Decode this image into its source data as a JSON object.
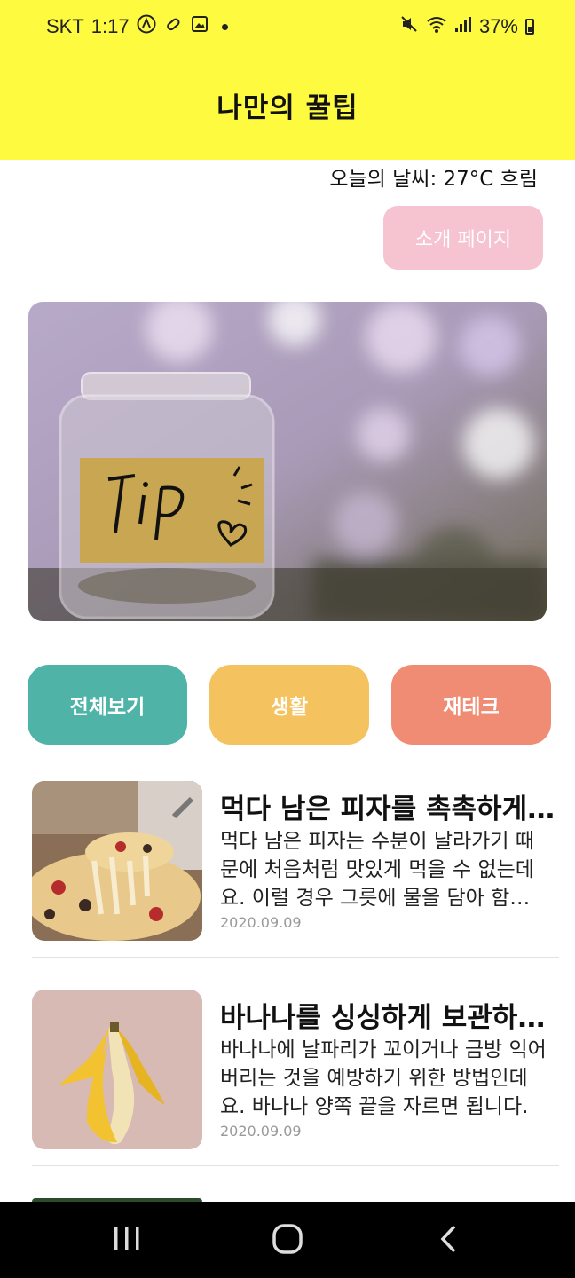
{
  "status_bar": {
    "carrier": "SKT",
    "time": "1:17",
    "battery": "37%",
    "icons_left": [
      "app-a-icon",
      "link-icon",
      "image-icon",
      "dot-icon"
    ],
    "icons_right": [
      "mute-icon",
      "wifi-icon",
      "signal-icon",
      "battery-icon"
    ]
  },
  "header": {
    "title": "나만의 꿀팁",
    "background": "#fdfa3f"
  },
  "weather": "오늘의 날씨: 27°C 흐림",
  "intro_button": {
    "label": "소개 페이지",
    "color": "#f5c4d0"
  },
  "hero": {
    "label_text": "TiP"
  },
  "categories": [
    {
      "label": "전체보기",
      "color": "#4fb3a8"
    },
    {
      "label": "생활",
      "color": "#f4c35f"
    },
    {
      "label": "재테크",
      "color": "#f08c73"
    }
  ],
  "tips": [
    {
      "title": "먹다 남은 피자를 촉촉하게 만드는 방법",
      "desc": "먹다 남은 피자는 수분이 날라가기 때문에 처음처럼 맛있게 먹을 수 없는데요. 이럴 경우 그릇에 물을 담아 함께 데워주세요.",
      "date": "2020.09.09",
      "thumb_icon": "pizza-image"
    },
    {
      "title": "바나나를 싱싱하게 보관하는 방법",
      "desc": "바나나에 날파리가 꼬이거나 금방 익어버리는 것을 예방하기 위한 방법인데요. 바나나 양쪽 끝을 자르면 됩니다.",
      "date": "2020.09.09",
      "thumb_icon": "banana-image"
    }
  ],
  "navbar": {
    "buttons": [
      "recent-apps-icon",
      "home-icon",
      "back-icon"
    ]
  }
}
